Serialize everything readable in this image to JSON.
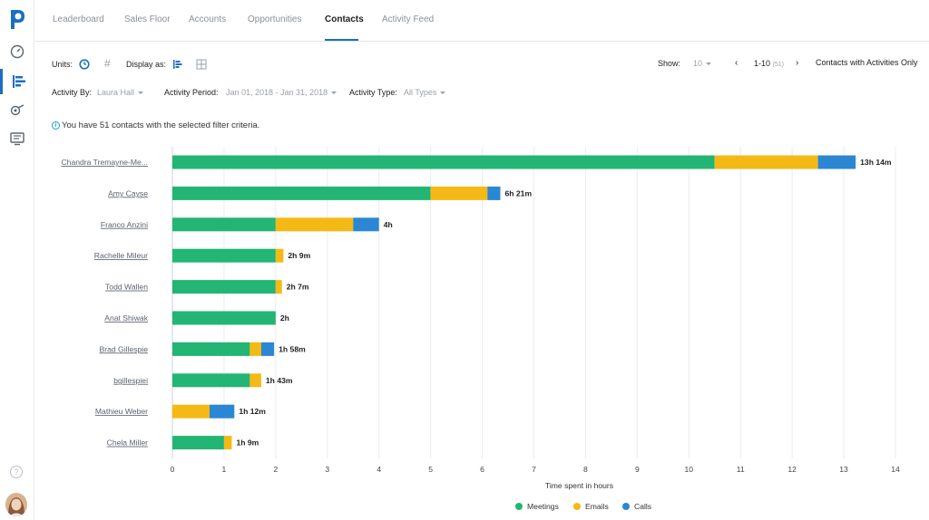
{
  "nav": {
    "tabs": [
      {
        "label": "Leaderboard"
      },
      {
        "label": "Sales Floor"
      },
      {
        "label": "Accounts"
      },
      {
        "label": "Opportunities"
      },
      {
        "label": "Contacts"
      },
      {
        "label": "Activity Feed"
      }
    ],
    "active_tab": "Contacts"
  },
  "sidebar": {
    "icons": [
      "logo-icon",
      "dashboard-icon",
      "reports-icon",
      "goals-icon",
      "tv-icon",
      "help-icon",
      "avatar"
    ],
    "active": "reports-icon"
  },
  "controls": {
    "units_label": "Units:",
    "display_as_label": "Display as:",
    "show_label": "Show:",
    "show_value": "10",
    "page_range": "1-10",
    "page_total": "(51)",
    "contacts_filter": "Contacts with Activities Only",
    "activity_by_label": "Activity By:",
    "activity_by_value": "Laura Hall",
    "activity_period_label": "Activity Period:",
    "activity_period_value": "Jan 01, 2018 - Jan 31, 2018",
    "activity_type_label": "Activity Type:",
    "activity_type_value": "All Types"
  },
  "info_text": "You have 51 contacts with the selected filter criteria.",
  "colors": {
    "meetings": "#22b573",
    "emails": "#f5b915",
    "calls": "#2b87d3",
    "accent": "#1a6fc2"
  },
  "chart_data": {
    "type": "bar",
    "orientation": "horizontal",
    "stacked": true,
    "categories": [
      "Chandra Tremayne-Me...",
      "Amy Cayse",
      "Franco Anzini",
      "Rachelle Mileur",
      "Todd Wallen",
      "Anat Shiwak",
      "Brad Gillespie",
      "bgillespiei",
      "Mathieu Weber",
      "Chela Miller"
    ],
    "series": [
      {
        "name": "Meetings",
        "values": [
          10.5,
          5.0,
          2.0,
          2.0,
          2.0,
          2.0,
          1.5,
          1.5,
          0,
          1.0
        ]
      },
      {
        "name": "Emails",
        "values": [
          2.0,
          1.1,
          1.5,
          0.15,
          0.12,
          0,
          0.22,
          0.22,
          0.72,
          0.15
        ]
      },
      {
        "name": "Calls",
        "values": [
          0.73,
          0.25,
          0.5,
          0,
          0,
          0,
          0.25,
          0,
          0.48,
          0
        ]
      }
    ],
    "totals": [
      "13h 14m",
      "6h 21m",
      "4h",
      "2h 9m",
      "2h 7m",
      "2h",
      "1h 58m",
      "1h 43m",
      "1h 12m",
      "1h 9m"
    ],
    "xlim": [
      0,
      14
    ],
    "xticks": [
      0,
      1,
      2,
      3,
      4,
      5,
      6,
      7,
      8,
      9,
      10,
      11,
      12,
      13,
      14
    ],
    "xlabel": "Time spent in hours",
    "grid": true,
    "legend_position": "bottom"
  }
}
